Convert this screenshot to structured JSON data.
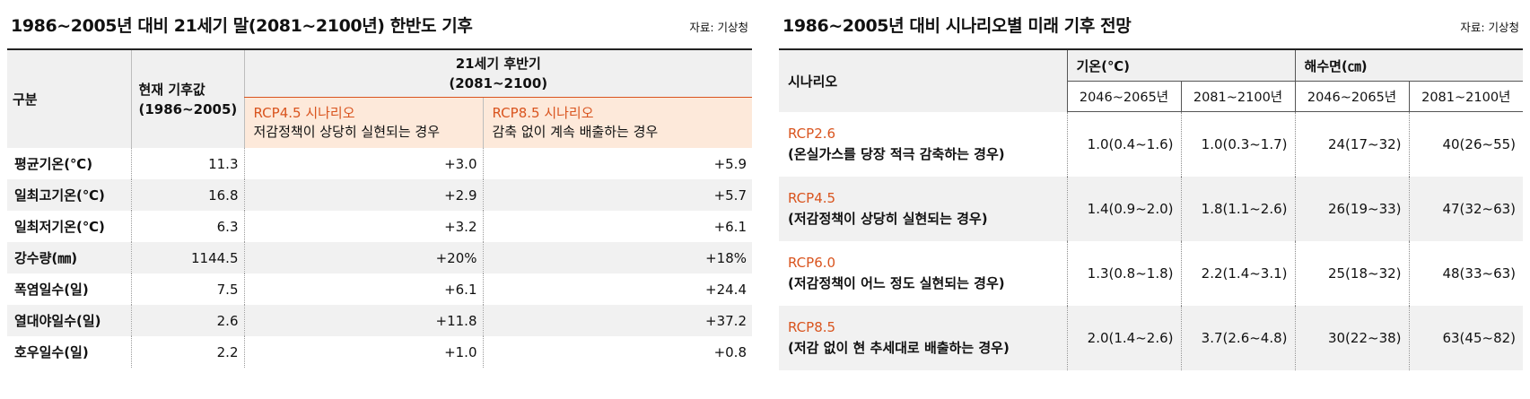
{
  "left": {
    "title": "1986~2005년 대비 21세기 말(2081~2100년) 한반도 기후",
    "source": "자료: 기상청",
    "header": {
      "category": "구분",
      "current_line1": "현재 기후값",
      "current_line2": "(1986~2005)",
      "future_line1": "21세기 후반기",
      "future_line2": "(2081~2100)",
      "rcp45_name": "RCP4.5 시나리오",
      "rcp45_desc": "저감정책이 상당히 실현되는 경우",
      "rcp85_name": "RCP8.5 시나리오",
      "rcp85_desc": "감축 없이 계속 배출하는 경우"
    },
    "rows": [
      {
        "label": "평균기온(℃)",
        "current": "11.3",
        "rcp45": "+3.0",
        "rcp85": "+5.9"
      },
      {
        "label": "일최고기온(℃)",
        "current": "16.8",
        "rcp45": "+2.9",
        "rcp85": "+5.7"
      },
      {
        "label": "일최저기온(℃)",
        "current": "6.3",
        "rcp45": "+3.2",
        "rcp85": "+6.1"
      },
      {
        "label": "강수량(㎜)",
        "current": "1144.5",
        "rcp45": "+20%",
        "rcp85": "+18%"
      },
      {
        "label": "폭염일수(일)",
        "current": "7.5",
        "rcp45": "+6.1",
        "rcp85": "+24.4"
      },
      {
        "label": "열대야일수(일)",
        "current": "2.6",
        "rcp45": "+11.8",
        "rcp85": "+37.2"
      },
      {
        "label": "호우일수(일)",
        "current": "2.2",
        "rcp45": "+1.0",
        "rcp85": "+0.8"
      }
    ]
  },
  "right": {
    "title": "1986~2005년 대비 시나리오별 미래 기후 전망",
    "source": "자료: 기상청",
    "header": {
      "scenario": "시나리오",
      "temp": "기온(℃)",
      "sea": "해수면(㎝)",
      "p1": "2046~2065년",
      "p2": "2081~2100년",
      "p3": "2046~2065년",
      "p4": "2081~2100년"
    },
    "rows": [
      {
        "name": "RCP2.6",
        "desc": "(온실가스를 당장 적극 감축하는 경우)",
        "t1": "1.0(0.4~1.6)",
        "t2": "1.0(0.3~1.7)",
        "s1": "24(17~32)",
        "s2": "40(26~55)"
      },
      {
        "name": "RCP4.5",
        "desc": "(저감정책이 상당히 실현되는 경우)",
        "t1": "1.4(0.9~2.0)",
        "t2": "1.8(1.1~2.6)",
        "s1": "26(19~33)",
        "s2": "47(32~63)"
      },
      {
        "name": "RCP6.0",
        "desc": "(저감정책이 어느 정도 실현되는 경우)",
        "t1": "1.3(0.8~1.8)",
        "t2": "2.2(1.4~3.1)",
        "s1": "25(18~32)",
        "s2": "48(33~63)"
      },
      {
        "name": "RCP8.5",
        "desc": "(저감 없이 현 추세대로 배출하는 경우)",
        "t1": "2.0(1.4~2.6)",
        "t2": "3.7(2.6~4.8)",
        "s1": "30(22~38)",
        "s2": "63(45~82)"
      }
    ]
  },
  "colors": {
    "accent": "#d9541e",
    "header_bg": "#f0f0f0",
    "rcp_header_bg": "#fde9da",
    "alt_row_bg": "#f1f1f1"
  }
}
